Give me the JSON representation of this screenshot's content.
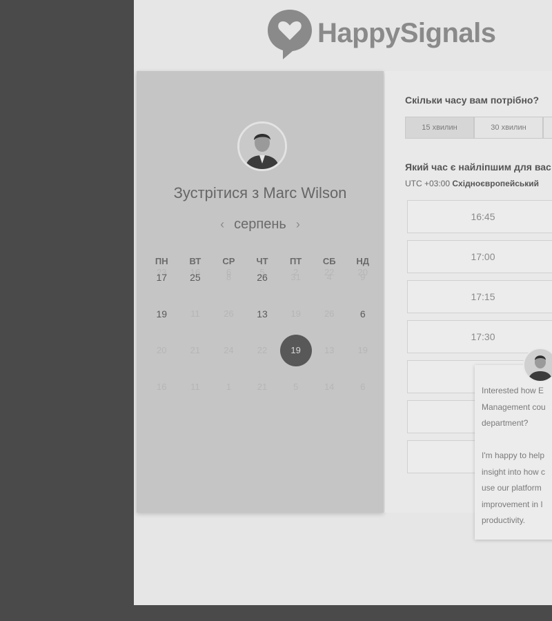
{
  "brand": {
    "name": "HappySignals"
  },
  "calendar": {
    "title_prefix": "Зустрітися з ",
    "host_name": "Marc Wilson",
    "month": "серпень",
    "prev_icon": "chevron-left-icon",
    "next_icon": "chevron-right-icon",
    "weekdays": [
      "ПН",
      "ВТ",
      "СР",
      "ЧТ",
      "ПТ",
      "СБ",
      "НД"
    ],
    "weeks": [
      [
        "23",
        "16",
        "6",
        "5",
        "2",
        "22",
        "20"
      ],
      [
        "17",
        "25",
        "8",
        "26",
        "31",
        "4",
        "9"
      ],
      [
        "19",
        "11",
        "26",
        "13",
        "19",
        "26",
        "6"
      ],
      [
        "20",
        "21",
        "24",
        "22",
        "19",
        "13",
        "19"
      ],
      [
        "16",
        "11",
        "1",
        "21",
        "5",
        "14",
        "6"
      ]
    ],
    "available": [
      [
        1,
        0
      ],
      [
        1,
        1
      ],
      [
        1,
        3
      ],
      [
        2,
        0
      ],
      [
        2,
        3
      ],
      [
        2,
        6
      ]
    ],
    "selected": [
      3,
      4
    ]
  },
  "scheduler": {
    "duration_question": "Скільки часу вам потрібно?",
    "durations": [
      "15 хвилин",
      "30 хвилин",
      ""
    ],
    "active_duration": 0,
    "time_question": "Який час є найліпшим для вас",
    "timezone_offset": "UTC +03:00",
    "timezone_name": "Східноєвропейський",
    "slots": [
      "16:45",
      "17:00",
      "17:15",
      "17:30",
      "",
      "",
      ""
    ]
  },
  "chat": {
    "text": "Interested how E\nManagement cou\ndepartment?\n\nI'm happy to help\ninsight into how c\nuse our platform\nimprovement in I\nproductivity."
  }
}
